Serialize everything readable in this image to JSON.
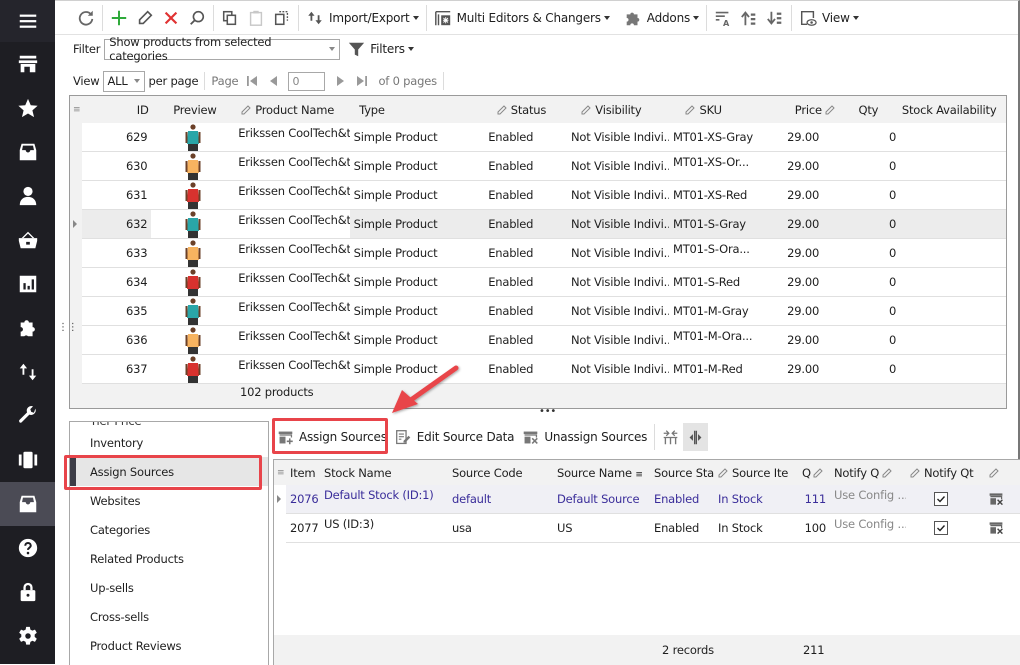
{
  "sidebar": {
    "items": [
      {
        "name": "menu-icon"
      },
      {
        "name": "store-icon"
      },
      {
        "name": "star-icon"
      },
      {
        "name": "archive-icon"
      },
      {
        "name": "user-icon"
      },
      {
        "name": "basket-icon"
      },
      {
        "name": "chart-icon"
      },
      {
        "name": "puzzle-icon"
      },
      {
        "name": "import-export-icon"
      },
      {
        "name": "wrench-icon"
      },
      {
        "name": "carousel-icon"
      },
      {
        "name": "inventory-icon",
        "active": true
      },
      {
        "name": "help-icon"
      },
      {
        "name": "lock-icon"
      },
      {
        "name": "settings-icon"
      }
    ]
  },
  "toolbar": {
    "import_export": "Import/Export",
    "multi_editors": "Multi Editors & Changers",
    "addons": "Addons",
    "view": "View"
  },
  "filter": {
    "label": "Filter",
    "value": "Show products from selected categories",
    "filters_label": "Filters"
  },
  "pager": {
    "view_label": "View",
    "per_page_value": "ALL",
    "per_page_label": "per page",
    "page_label": "Page",
    "page_value": "0",
    "of_pages": "of 0 pages"
  },
  "products": {
    "columns": [
      "ID",
      "Preview",
      "Product Name",
      "Type",
      "Status",
      "Visibility",
      "SKU",
      "Price",
      "Qty",
      "Stock Availability"
    ],
    "rows": [
      {
        "id": "629",
        "color": "#2aa6a8",
        "name": "Erikssen CoolTech&t...",
        "type": "Simple Product",
        "status": "Enabled",
        "visibility": "Not Visible Indivi...",
        "sku": "MT01-XS-Gray",
        "price": "29.00",
        "qty": "0",
        "stock": ""
      },
      {
        "id": "630",
        "color": "#f7b360",
        "name": "Erikssen CoolTech&t...",
        "type": "Simple Product",
        "status": "Enabled",
        "visibility": "Not Visible Indivi...",
        "sku": "MT01-XS-Or...",
        "price": "29.00",
        "qty": "0",
        "stock": ""
      },
      {
        "id": "631",
        "color": "#d8322e",
        "name": "Erikssen CoolTech&t...",
        "type": "Simple Product",
        "status": "Enabled",
        "visibility": "Not Visible Indivi...",
        "sku": "MT01-XS-Red",
        "price": "29.00",
        "qty": "0",
        "stock": ""
      },
      {
        "id": "632",
        "color": "#2aa6a8",
        "name": "Erikssen CoolTech&t...",
        "type": "Simple Product",
        "status": "Enabled",
        "visibility": "Not Visible Indivi...",
        "sku": "MT01-S-Gray",
        "price": "29.00",
        "qty": "0",
        "stock": "",
        "selected": true
      },
      {
        "id": "633",
        "color": "#f7b360",
        "name": "Erikssen CoolTech&t...",
        "type": "Simple Product",
        "status": "Enabled",
        "visibility": "Not Visible Indivi...",
        "sku": "MT01-S-Ora...",
        "price": "29.00",
        "qty": "0",
        "stock": ""
      },
      {
        "id": "634",
        "color": "#d8322e",
        "name": "Erikssen CoolTech&t...",
        "type": "Simple Product",
        "status": "Enabled",
        "visibility": "Not Visible Indivi...",
        "sku": "MT01-S-Red",
        "price": "29.00",
        "qty": "0",
        "stock": ""
      },
      {
        "id": "635",
        "color": "#2aa6a8",
        "name": "Erikssen CoolTech&t...",
        "type": "Simple Product",
        "status": "Enabled",
        "visibility": "Not Visible Indivi...",
        "sku": "MT01-M-Gray",
        "price": "29.00",
        "qty": "0",
        "stock": ""
      },
      {
        "id": "636",
        "color": "#f7b360",
        "name": "Erikssen CoolTech&t...",
        "type": "Simple Product",
        "status": "Enabled",
        "visibility": "Not Visible Indivi...",
        "sku": "MT01-M-Ora...",
        "price": "29.00",
        "qty": "0",
        "stock": ""
      },
      {
        "id": "637",
        "color": "#d8322e",
        "name": "Erikssen CoolTech&t...",
        "type": "Simple Product",
        "status": "Enabled",
        "visibility": "Not Visible Indivi...",
        "sku": "MT01-M-Red",
        "price": "29.00",
        "qty": "0",
        "stock": ""
      }
    ],
    "footer": "102 products"
  },
  "side_tabs": {
    "partial": "Tier Price",
    "items": [
      "Inventory",
      "Assign Sources",
      "Websites",
      "Categories",
      "Related Products",
      "Up-sells",
      "Cross-sells",
      "Product Reviews"
    ],
    "active": "Assign Sources"
  },
  "sources_toolbar": {
    "assign": "Assign Sources",
    "edit": "Edit Source Data",
    "unassign": "Unassign Sources"
  },
  "sources": {
    "columns": [
      "Item",
      "Stock Name",
      "Source Code",
      "Source Name",
      "Source Sta",
      "Source Ite",
      "Q",
      "Notify Q",
      "Notify Qt",
      ""
    ],
    "rows": [
      {
        "item": "2076",
        "stock": "Default Stock (ID:1)",
        "code": "default",
        "name": "Default Source",
        "status": "Enabled",
        "source_item": "In Stock",
        "qty": "111",
        "notify": "Use Config ...",
        "notify_checked": true,
        "selected": true
      },
      {
        "item": "2077",
        "stock": "US (ID:3)",
        "code": "usa",
        "name": "US",
        "status": "Enabled",
        "source_item": "In Stock",
        "qty": "100",
        "notify": "Use Config ...",
        "notify_checked": true
      }
    ],
    "footer_records": "2 records",
    "footer_qty_total": "211"
  },
  "colors": {
    "accent_highlight": "#e8444a",
    "sidebar_bg": "#1e1e23",
    "selected_link": "#3a2d9a"
  }
}
